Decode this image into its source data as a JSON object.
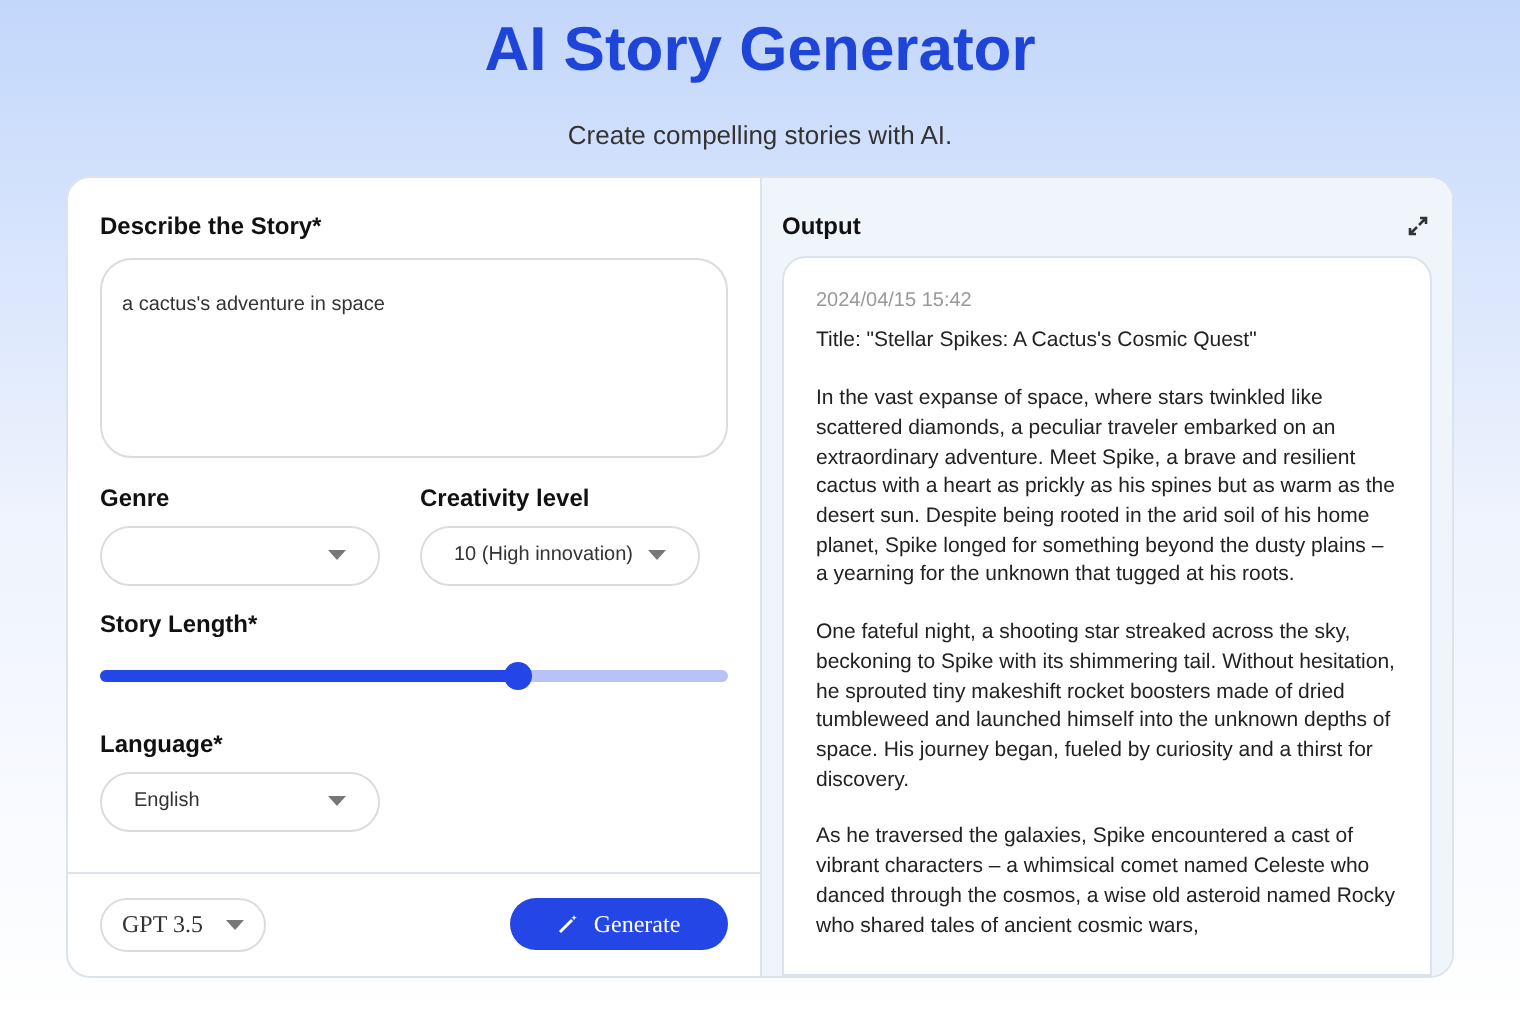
{
  "header": {
    "title": "AI Story Generator",
    "subtitle": "Create compelling stories with AI."
  },
  "form": {
    "description": {
      "label": "Describe the Story*",
      "value": "a cactus's adventure in space"
    },
    "genre": {
      "label": "Genre"
    },
    "creativity": {
      "label": "Creativity level",
      "value": "10 (High innovation)"
    },
    "story_length": {
      "label": "Story Length*",
      "level": 0.667
    },
    "language": {
      "label": "Language*",
      "value": "English"
    },
    "model": {
      "value": "GPT 3.5"
    },
    "generate_button": {
      "label": "Generate"
    }
  },
  "output": {
    "title": "Output",
    "timestamp": "2024/04/15 15:42",
    "story_title": "Title: \"Stellar Spikes: A Cactus's Cosmic Quest\"",
    "paragraphs": [
      "In the vast expanse of space, where stars twinkled like scattered diamonds, a peculiar traveler embarked on an extraordinary adventure. Meet Spike, a brave and resilient cactus with a heart as prickly as his spines but as warm as the desert sun. Despite being rooted in the arid soil of his home planet, Spike longed for something beyond the dusty plains – a yearning for the unknown that tugged at his roots.",
      "One fateful night, a shooting star streaked across the sky, beckoning to Spike with its shimmering tail. Without hesitation, he sprouted tiny makeshift rocket boosters made of dried tumbleweed and launched himself into the unknown depths of space. His journey began, fueled by curiosity and a thirst for discovery.",
      "As he traversed the galaxies, Spike encountered a cast of vibrant characters – a whimsical comet named Celeste who danced through the cosmos, a wise old asteroid named Rocky who shared tales of ancient cosmic wars,"
    ]
  }
}
